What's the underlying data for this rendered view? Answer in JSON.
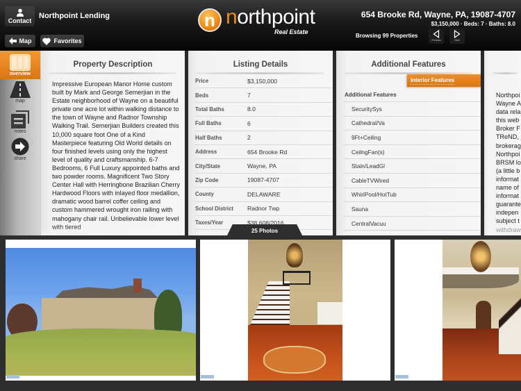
{
  "header": {
    "contact_label": "Contact",
    "lender_name": "Northpoint Lending",
    "map_label": "Map",
    "favorites_label": "Favorites",
    "logo": {
      "letter": "n",
      "word_first": "n",
      "word_rest": "orthpoint",
      "subtitle": "Real Estate"
    },
    "address": "654 Brooke Rd, Wayne, PA, 19087-4707",
    "summary": "$3,150,000 · Beds: 7 · Baths: 8.0",
    "browsing": "Browsing 99 Properties",
    "previous_label": "Previous",
    "next_label": "Next"
  },
  "sidebar": {
    "items": [
      {
        "label": "overview",
        "icon": "overview-icon",
        "active": true
      },
      {
        "label": "map",
        "icon": "road-icon",
        "active": false
      },
      {
        "label": "notes",
        "icon": "notes-icon",
        "active": false
      },
      {
        "label": "share",
        "icon": "share-arrow-icon",
        "active": false
      }
    ]
  },
  "description": {
    "title": "Property Description",
    "text": "Impressive European Manor Home custom built by Mark and George Semerjian in the Estate neighborhood of Wayne on a beautiful private one acre lot within walking distance to the town of Wayne and Radnor Township Walking Trail.  Semerjian Builders created this 10,000 square foot One of a Kind Masterpiece featuring Old World details on four finished levels using only the highest level of quality and craftsmanship.  6-7 Bedrooms, 6 Full Luxury appointed baths and two powder rooms.  Magnificent Two Story Center Hall with Herringbone Brazilian Cherry Hardwood Floors with inlayed floor medallion, dramatic wood barrel coffer ceiling and custom hammered wrought iron railing with mahogany chair rail.  Unbelievable lower level with tiered"
  },
  "listing": {
    "title": "Listing Details",
    "rows": [
      {
        "label": "Price",
        "value": "$3,150,000"
      },
      {
        "label": "Beds",
        "value": "7"
      },
      {
        "label": "Total Baths",
        "value": "8.0"
      },
      {
        "label": "Full Baths",
        "value": "6"
      },
      {
        "label": "Half Baths",
        "value": "2"
      },
      {
        "label": "Address",
        "value": "654 Brooke Rd"
      },
      {
        "label": "City/State",
        "value": "Wayne, PA"
      },
      {
        "label": "Zip Code",
        "value": "19087-4707"
      },
      {
        "label": "County",
        "value": "DELAWARE"
      },
      {
        "label": "School District",
        "value": "Radnor Twp"
      },
      {
        "label": "Taxes/Year",
        "value": "$38,608/2016"
      }
    ]
  },
  "features": {
    "title": "Additional Features",
    "active_tab": "Interior Features",
    "section_header": "Additional Features",
    "items": [
      "SecuritySys",
      "Cathedral/Va",
      "9Ft+Ceiling",
      "CeilngFan(s)",
      "Stain/LeadGl",
      "CableTVWired",
      "WhirlPool/HotTub",
      "Sauna",
      "CentralVacuu"
    ]
  },
  "disclaimer": {
    "lines": [
      "Northpoi",
      "Wayne A",
      "data rela",
      "this web",
      "Broker F",
      "TReND,",
      "brokerag",
      "Northpoi",
      "BRSM lo",
      "(a little b",
      "informat",
      "name of",
      "informat",
      "guarante",
      "indepen",
      "subject t",
      "withdraw"
    ]
  },
  "photos": {
    "tab_label": "25 Photos",
    "items": [
      {
        "name": "exterior-photo",
        "caption": ""
      },
      {
        "name": "foyer-staircase-photo",
        "caption": ""
      },
      {
        "name": "center-hall-photo",
        "caption": ""
      }
    ]
  },
  "colors": {
    "accent": "#e8831b",
    "header_bg": "#111111",
    "panel_bg": "#f5f5f5"
  }
}
